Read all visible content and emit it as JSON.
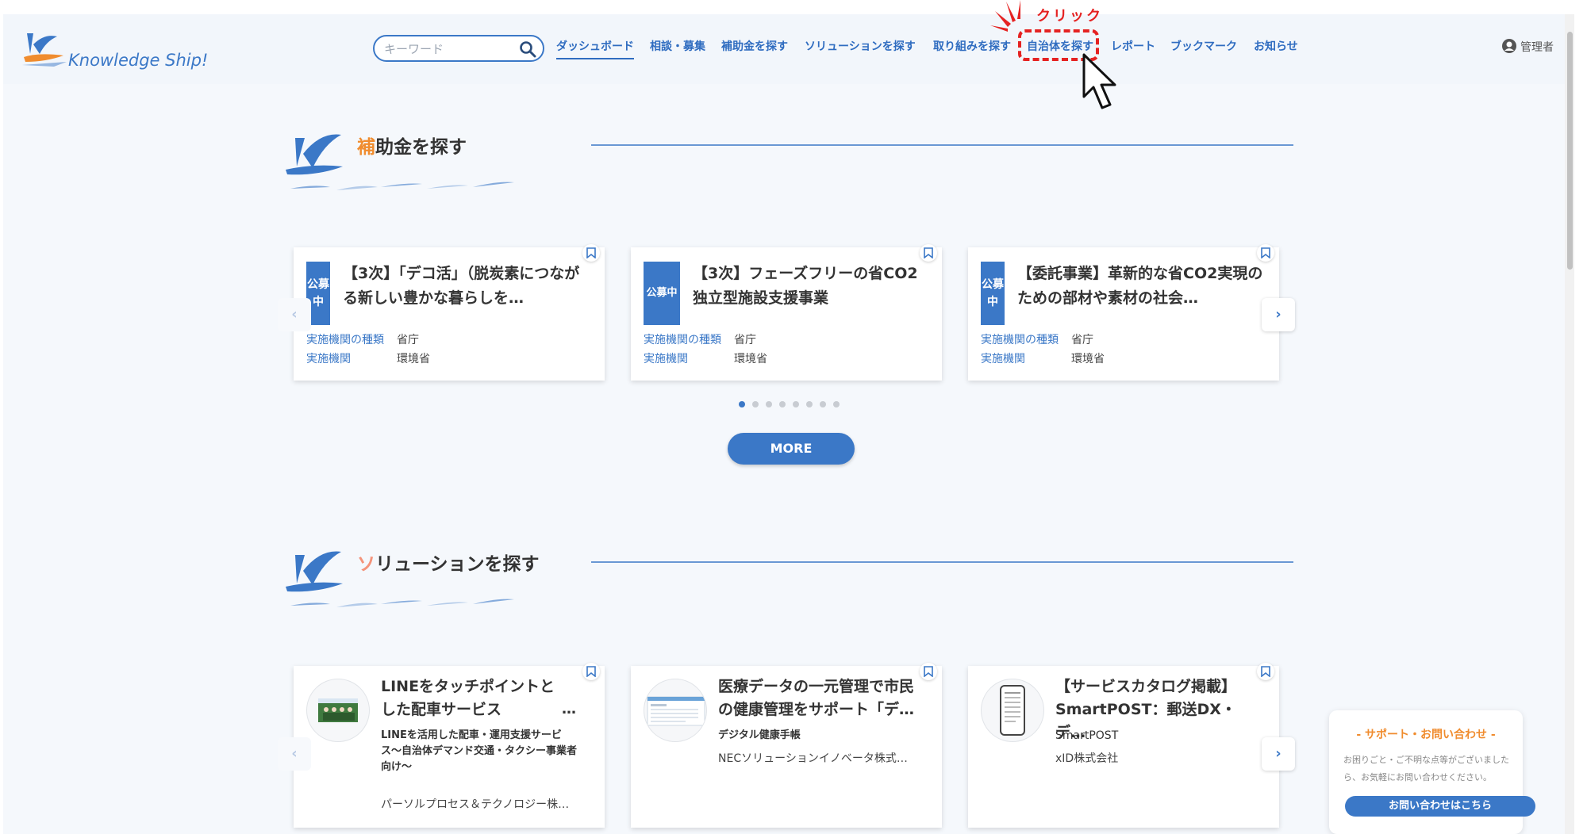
{
  "header": {
    "logo_text": "Knowledge Ship!",
    "search_placeholder": "キーワード",
    "nav": [
      "ダッシュボード",
      "相談・募集",
      "補助金を探す",
      "ソリューションを探す",
      "取り組みを探す",
      "自治体を探す",
      "レポート",
      "ブックマーク",
      "お知らせ"
    ],
    "active_nav": "ダッシュボード",
    "user": "管理者"
  },
  "annotation": {
    "label": "クリック",
    "target": "自治体を探す",
    "color": "#e52222"
  },
  "subsidy_section": {
    "title_first": "補",
    "title_rest": "助金を探す",
    "cards": [
      {
        "status": "公募中",
        "title": "【3次】「デコ活」（脱炭素につながる新しい豊かな暮らしを…",
        "meta": [
          [
            "実施機関の種類",
            "省庁"
          ],
          [
            "実施機関",
            "環境省"
          ]
        ]
      },
      {
        "status": "公募中",
        "title": "【3次】フェーズフリーの省CO2独立型施設支援事業",
        "meta": [
          [
            "実施機関の種類",
            "省庁"
          ],
          [
            "実施機関",
            "環境省"
          ]
        ]
      },
      {
        "status": "公募中",
        "title": "【委託事業】革新的な省CO2実現のための部材や素材の社会…",
        "meta": [
          [
            "実施機関の種類",
            "省庁"
          ],
          [
            "実施機関",
            "環境省"
          ]
        ]
      }
    ],
    "pager_total": 8,
    "pager_active": 0,
    "more_label": "MORE"
  },
  "solution_section": {
    "title_first": "ソ",
    "title_rest": "リューションを探す",
    "cards": [
      {
        "title": "LINEをタッチポイントとした配車サービス",
        "ellipsis": "…",
        "subtitle": "LINEを活用した配車・運用支援サービス〜自治体デマンド交通・タクシー事業者向け〜",
        "company": "パーソルプロセス＆テクノロジー株…"
      },
      {
        "title": "医療データの一元管理で市民の健康管理をサポート「デ…",
        "subtitle": "デジタル健康手帳",
        "company": "NECソリューションイノベータ株式…"
      },
      {
        "title": "【サービスカタログ掲載】SmartPOST：郵送DX・デ…",
        "subtitle": "SmartPOST",
        "company": "xID株式会社"
      }
    ]
  },
  "support": {
    "title": "- サポート・お問い合わせ -",
    "text": "お困りごと・ご不明な点等がございましたら、お気軽にお問い合わせください。",
    "button": "お問い合わせはこちら"
  },
  "colors": {
    "accent": "#3b78c7",
    "orange": "#f08c2e",
    "annotation": "#e52222"
  }
}
